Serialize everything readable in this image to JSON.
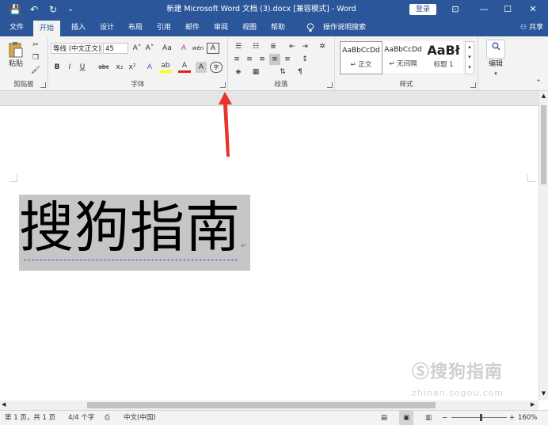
{
  "window": {
    "title": "新建 Microsoft Word 文档 (3).docx [兼容模式]  -  Word",
    "login_label": "登录"
  },
  "quick_access": {
    "save": "💾",
    "undo": "↶",
    "redo": "↻",
    "more": "⌄"
  },
  "window_buttons": {
    "ribbon_opts": "⊡",
    "minimize": "—",
    "maximize": "☐",
    "close": "✕"
  },
  "tabs": [
    {
      "label": "文件"
    },
    {
      "label": "开始"
    },
    {
      "label": "插入"
    },
    {
      "label": "设计"
    },
    {
      "label": "布局"
    },
    {
      "label": "引用"
    },
    {
      "label": "邮件"
    },
    {
      "label": "审阅"
    },
    {
      "label": "视图"
    },
    {
      "label": "帮助"
    },
    {
      "label": "操作说明搜索"
    }
  ],
  "share_label": "共享",
  "ribbon": {
    "clipboard": {
      "label": "剪贴板",
      "paste_label": "粘贴"
    },
    "font": {
      "label": "字体",
      "font_name": "等线 (中文正文)",
      "font_size": "45",
      "grow": "A˄",
      "shrink": "A˅",
      "case": "Aa",
      "clear": "A",
      "phonetic": "wén",
      "border_char": "A",
      "bold": "B",
      "italic": "I",
      "underline": "U",
      "strike": "abc",
      "sub": "x₂",
      "sup": "x²",
      "effects": "A",
      "highlight": "ab",
      "color": "A",
      "shading": "A",
      "circle": "字"
    },
    "paragraph": {
      "label": "段落"
    },
    "styles": {
      "label": "样式",
      "items": [
        {
          "sample": "AaBbCcDd",
          "name": "↵ 正文"
        },
        {
          "sample": "AaBbCcDd",
          "name": "↵ 无间隔"
        },
        {
          "sample": "AaBł",
          "name": "标题 1"
        }
      ]
    },
    "editing": {
      "label": "编辑"
    }
  },
  "document": {
    "text": "搜狗指南",
    "para_mark": "↵"
  },
  "watermark": {
    "brand": "搜狗指南",
    "url": "zhinan.sogou.com"
  },
  "status": {
    "page": "第 1 页，共 1 页",
    "words": "4/4 个字",
    "language": "中文(中国)",
    "zoom": "160%"
  },
  "colors": {
    "accent": "#2b579a",
    "annotation_arrow": "#e8342a"
  }
}
